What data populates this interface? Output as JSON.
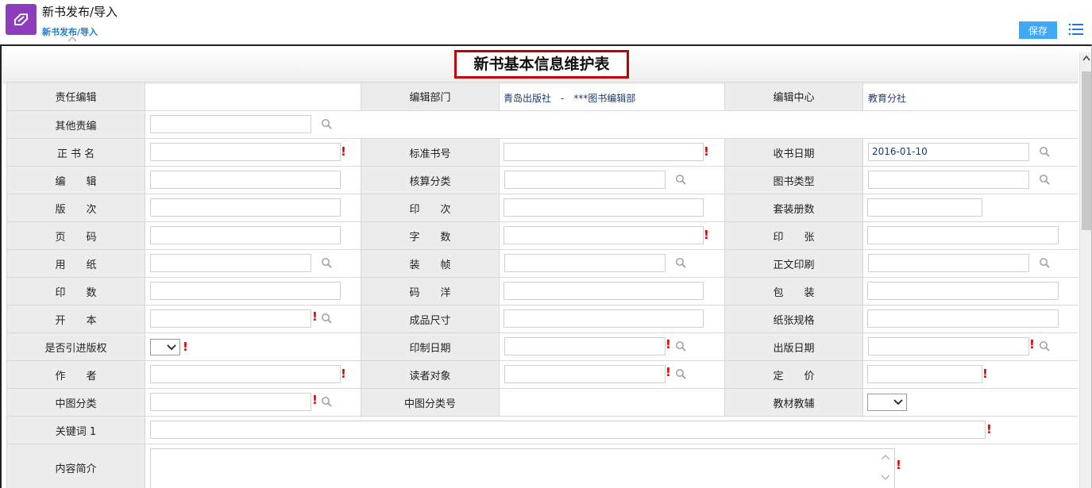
{
  "header": {
    "app_title": "新书发布/导入",
    "breadcrumb": "新书发布/导入",
    "save_label": "保存"
  },
  "form": {
    "title": "新书基本信息维护表",
    "labels": {
      "chief_editor": "责任编辑",
      "edit_dept": "编辑部门",
      "edit_center": "编辑中心",
      "other_editors": "其他责编",
      "book_name": "正 书 名",
      "isbn": "标准书号",
      "receive_date": "收书日期",
      "editor": "编　　辑",
      "accounting_class": "核算分类",
      "book_type": "图书类型",
      "edition": "版　　次",
      "impression": "印　　次",
      "set_volumes": "套装册数",
      "pages": "页　　码",
      "word_count": "字　　数",
      "print_sheets": "印　　张",
      "paper": "用　　纸",
      "binding": "装　　帧",
      "text_printing": "正文印刷",
      "print_run": "印　　数",
      "code_ocean": "码　　洋",
      "packaging": "包　　装",
      "format": "开　　本",
      "finished_size": "成品尺寸",
      "paper_spec": "纸张规格",
      "imported_copyright": "是否引进版权",
      "print_date": "印制日期",
      "publish_date": "出版日期",
      "author": "作　　者",
      "readers": "读者对象",
      "price": "定　　价",
      "clc_class": "中图分类",
      "clc_number": "中图分类号",
      "textbook_aid": "教材教辅",
      "keyword1": "关键词 1",
      "summary": "内容简介"
    },
    "values": {
      "edit_dept": "青岛出版社　-　***图书编辑部",
      "edit_center": "教育分社",
      "receive_date": "2016-01-10"
    }
  }
}
